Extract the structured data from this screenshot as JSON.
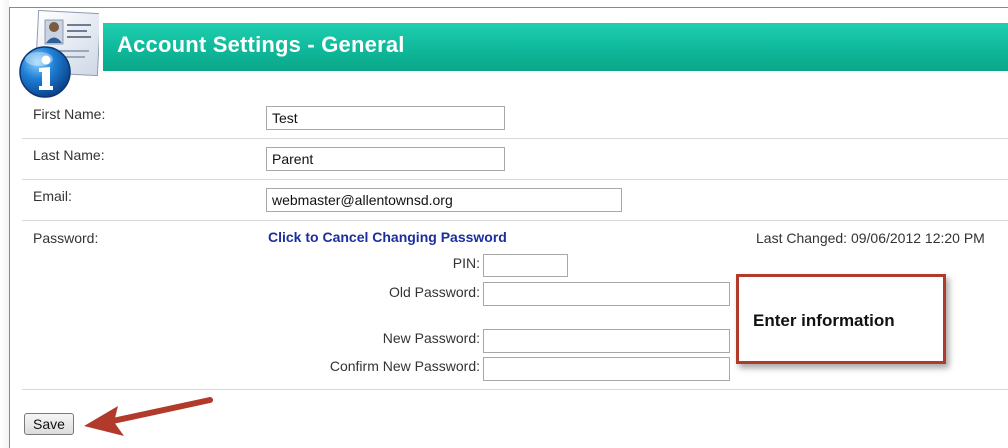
{
  "header": {
    "title": "Account Settings - General"
  },
  "form": {
    "first_name": {
      "label": "First Name:",
      "value": "Test"
    },
    "last_name": {
      "label": "Last Name:",
      "value": "Parent"
    },
    "email": {
      "label": "Email:",
      "value": "webmaster@allentownsd.org"
    },
    "password": {
      "label": "Password:",
      "cancel_link": "Click to Cancel Changing Password",
      "last_changed": "Last Changed: 09/06/2012 12:20 PM",
      "pin_label": "PIN:",
      "pin_value": "",
      "old_password_label": "Old Password:",
      "old_password_value": "",
      "new_password_label": "New Password:",
      "new_password_value": "",
      "confirm_password_label": "Confirm New Password:",
      "confirm_password_value": ""
    }
  },
  "callout": {
    "text": "Enter information",
    "border_color": "#b13a2a"
  },
  "actions": {
    "save_label": "Save"
  },
  "colors": {
    "header": "#0fb89a",
    "link": "#1a2f9c",
    "arrow": "#b13a2a"
  },
  "icons": {
    "header_icon": "info-icon",
    "pointer": "arrow-icon"
  }
}
